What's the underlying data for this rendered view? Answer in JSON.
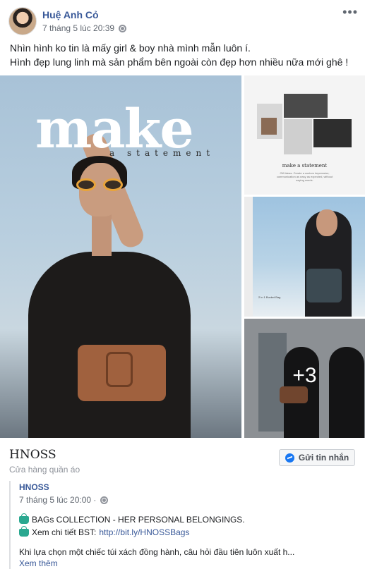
{
  "post": {
    "author": "Huệ Anh Cỏ",
    "timestamp": "7 tháng 5 lúc 20:39",
    "privacy_icon": "globe-icon",
    "more_icon": "more-options-icon",
    "text_line1": "Nhìn hình ko tin là mấy girl & boy nhà mình mẫn luôn í.",
    "text_line2": "Hình đẹp lung linh mà sản phẩm bên ngoài còn đẹp hơn nhiều nữa mới ghê !"
  },
  "gallery": {
    "main_title": "make",
    "main_subtitle": "a statement",
    "thumb1_caption": "make a statement",
    "thumb1_body": "Gift ideas. Create a custom impression; communication as easy as expected, without saying words.",
    "thumb2_tiny": "2 in 1 Bucket Bag",
    "more_count": "+3"
  },
  "page": {
    "name": "HNOSS",
    "category": "Cửa hàng quần áo",
    "message_button": "Gửi tin nhắn",
    "messenger_icon": "messenger-icon"
  },
  "shared_post": {
    "name": "HNOSS",
    "timestamp": "7 tháng 5 lúc 20:00 ·",
    "line1": "BAGs COLLECTION - HER PERSONAL BELONGINGS.",
    "line2_prefix": "Xem chi tiết BST:",
    "line2_link": "http://bit.ly/HNOSSBags",
    "line3": "Khi lựa chọn một chiếc túi xách đồng hành, câu hỏi đầu tiên luôn xuất h...",
    "see_more": "Xem thêm",
    "bag_icon": "handbag-icon"
  }
}
